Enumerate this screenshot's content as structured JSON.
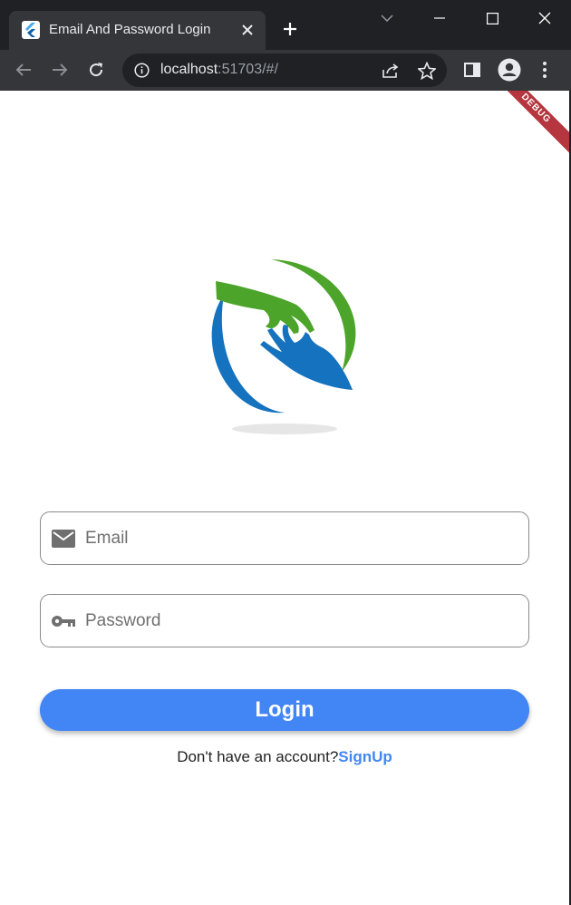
{
  "browser": {
    "tab_title": "Email And Password Login",
    "url_host": "localhost",
    "url_rest": ":51703/#/"
  },
  "page": {
    "debug_banner": "DEBUG",
    "email": {
      "placeholder": "Email",
      "value": "",
      "icon": "mail-icon"
    },
    "password": {
      "placeholder": "Password",
      "value": "",
      "icon": "key-icon"
    },
    "login_label": "Login",
    "signup_prompt": "Don't have an account?",
    "signup_link": "SignUp"
  },
  "colors": {
    "accent": "#4285f4",
    "logo_green": "#4ca52a",
    "logo_blue": "#1572bf",
    "debug": "#b5363f"
  }
}
